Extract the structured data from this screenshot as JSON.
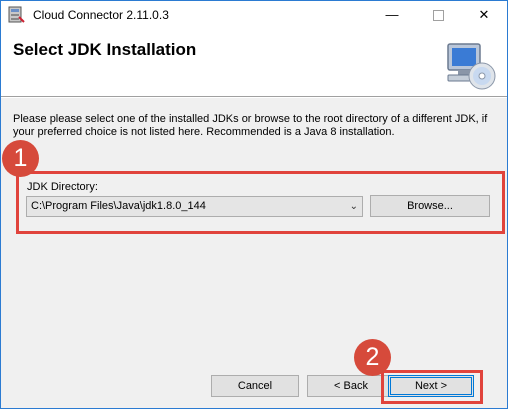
{
  "window": {
    "title": "Cloud Connector 2.11.0.3",
    "controls": {
      "minimize": "—",
      "maximize": "",
      "close": "✕"
    }
  },
  "banner": {
    "title": "Select JDK Installation",
    "graphic": "computer-cd-icon"
  },
  "description": "Please please select one of the installed JDKs or browse to the root directory of a different JDK, if your preferred choice is not listed here. Recommended is a Java 8 installation.",
  "jdk": {
    "label": "JDK Directory:",
    "selected": "C:\\Program Files\\Java\\jdk1.8.0_144",
    "browse_label": "Browse..."
  },
  "footer": {
    "cancel_label": "Cancel",
    "back_label": "< Back",
    "next_label": "Next >"
  },
  "callouts": [
    "1",
    "2"
  ],
  "colors": {
    "highlight": "#e0433c",
    "callout": "#d64a3b",
    "accent": "#0078d7"
  }
}
